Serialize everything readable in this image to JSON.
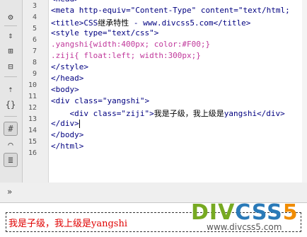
{
  "toolbar": {
    "buttons": [
      {
        "name": "gear-icon",
        "glyph": "⚙"
      },
      {
        "name": "expand-all-icon",
        "glyph": "⇕"
      },
      {
        "name": "collapse-tag-icon",
        "glyph": "⊞"
      },
      {
        "name": "expand-tag-icon",
        "glyph": "⊟"
      },
      {
        "name": "select-parent-icon",
        "glyph": "⇡"
      },
      {
        "name": "apply-comment-icon",
        "glyph": "{}"
      },
      {
        "name": "highlight-invalid-icon",
        "glyph": "#"
      },
      {
        "name": "wrap-tag-icon",
        "glyph": "⌒"
      },
      {
        "name": "format-source-icon",
        "glyph": "≣"
      }
    ]
  },
  "gutter": {
    "numbers": [
      "3",
      "4",
      "5",
      "6",
      "7",
      "8",
      "9",
      "10",
      "11",
      "12",
      "13",
      "14",
      "15",
      "16"
    ]
  },
  "code": {
    "line_head_partial": "<head>",
    "l3": "<meta http-equiv=\"Content-Type\" content=\"text/html;",
    "l4_a": "<title>CSS",
    "l4_b": "继承特性",
    "l4_c": " - www.divcss5.com</title>",
    "l5": "<style type=\"text/css\">",
    "l6": ".yangshi{width:400px; color:#F00;}",
    "l7": ".ziji{ float:left; width:300px;}",
    "l8": "</style>",
    "l9": "</head>",
    "l10": "<body>",
    "l11": "<div class=\"yangshi\">",
    "l12_a": "    <div class=\"ziji\">",
    "l12_b": "我是子级，我上级是",
    "l12_c": "yangshi</div>",
    "l13": "</div>",
    "l14": "</body>",
    "l15": "</html>"
  },
  "collapse_chevron": "»",
  "preview": {
    "output_text": "我是子级，我上级是yangshi"
  },
  "logo": {
    "main_a": "DIV",
    "main_b": "CSS",
    "main_c": "5",
    "url": "www.divcss5.com",
    "colors": {
      "div": "#77aa22",
      "css": "#2a7ab8",
      "five": "#f08c00"
    }
  }
}
